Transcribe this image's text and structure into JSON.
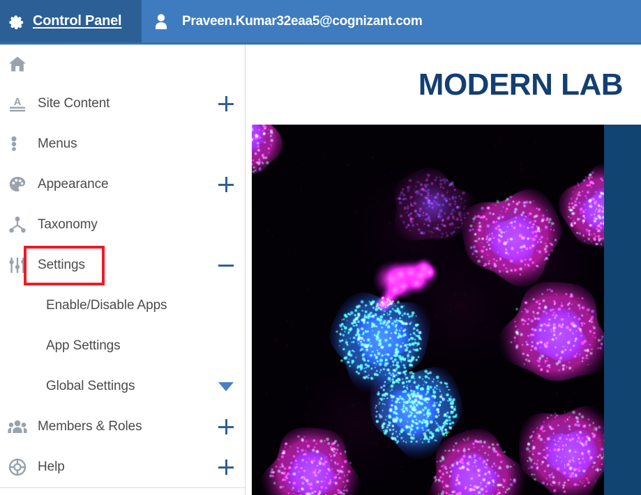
{
  "header": {
    "gear_icon": "gear-icon",
    "control_panel_label": "Control Panel",
    "user_icon": "user-avatar-icon",
    "user_email": "Praveen.Kumar32eaa5@cognizant.com",
    "bar_color": "#3e7cbf",
    "control_panel_bg": "#2b5f96"
  },
  "sidebar": {
    "items": [
      {
        "label": "",
        "icon": "home-icon",
        "toggle": "none"
      },
      {
        "label": "Site Content",
        "icon": "document-text-icon",
        "toggle": "plus"
      },
      {
        "label": "Menus",
        "icon": "menu-dots-icon",
        "toggle": "none"
      },
      {
        "label": "Appearance",
        "icon": "palette-icon",
        "toggle": "plus"
      },
      {
        "label": "Taxonomy",
        "icon": "taxonomy-tree-icon",
        "toggle": "none"
      },
      {
        "label": "Settings",
        "icon": "sliders-icon",
        "toggle": "minus"
      }
    ],
    "settings_subitems": [
      {
        "label": "Enable/Disable Apps",
        "toggle": "none"
      },
      {
        "label": "App Settings",
        "toggle": "none"
      },
      {
        "label": "Global Settings",
        "toggle": "caret-down"
      }
    ],
    "items_after": [
      {
        "label": "Members & Roles",
        "icon": "members-group-icon",
        "toggle": "plus"
      },
      {
        "label": "Help",
        "icon": "help-lifebuoy-icon",
        "toggle": "plus"
      }
    ],
    "highlight": {
      "target": "Settings",
      "color": "#ee1b24"
    },
    "toggle_color": "#2d6096",
    "caret_color": "#4a7fc1",
    "label_color": "#4b4b4b",
    "icon_color": "#9aa2ac"
  },
  "main": {
    "brand_title": "MODERN LAB",
    "brand_title_color": "#133f72",
    "right_band_color": "#114470",
    "hero_image": {
      "name": "fluorescence-microscopy-cells-image",
      "description": "Fluorescence microscopy of cultured cells with magenta and blue stained nuclei and green punctate speckles on a black background",
      "background": "#030006"
    }
  }
}
